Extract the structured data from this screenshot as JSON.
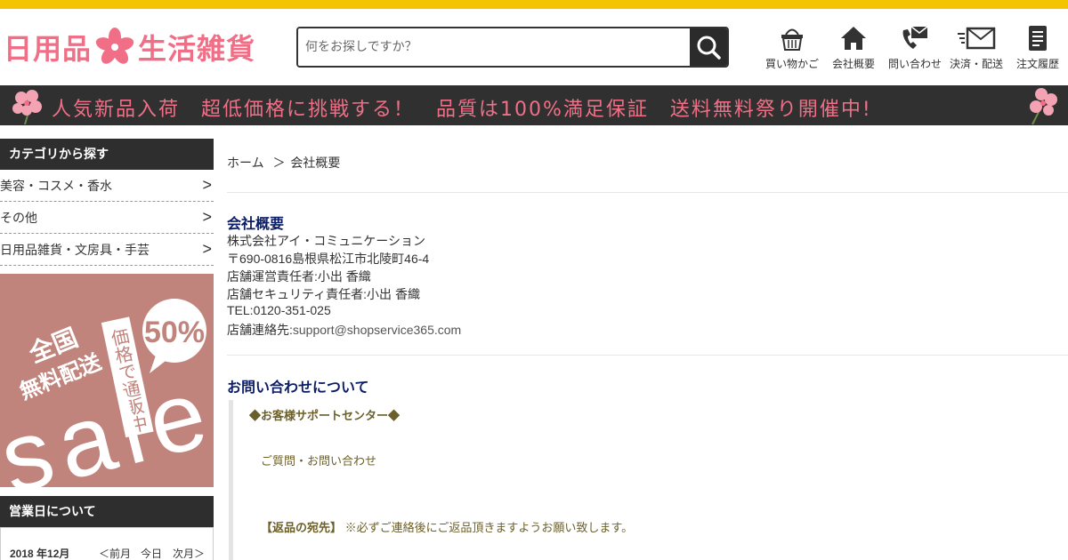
{
  "header": {
    "logo_left": "日用品",
    "logo_right": "生活雑貨",
    "search": {
      "placeholder": "何をお探しですか？"
    },
    "nav": [
      {
        "label": "買い物かご",
        "icon": "basket-icon"
      },
      {
        "label": "会社概要",
        "icon": "home-icon"
      },
      {
        "label": "問い合わせ",
        "icon": "phone-mail-icon"
      },
      {
        "label": "決済・配送",
        "icon": "fast-mail-icon"
      },
      {
        "label": "注文履歴",
        "icon": "document-icon"
      }
    ]
  },
  "banner": {
    "text": "人気新品入荷　超低価格に挑戦する！　品質は100%満足保証　送料無料祭り開催中!"
  },
  "sidebar": {
    "category_heading": "カテゴリから探す",
    "categories": [
      {
        "label": "美容・コスメ・香水",
        "arrow": ">"
      },
      {
        "label": "その他",
        "arrow": ">"
      },
      {
        "label": "日用品雑貨・文房具・手芸",
        "arrow": ">"
      }
    ],
    "sale_banner": {
      "line1": "全国",
      "line2": "無料配送",
      "vertical": "価格で通販中",
      "percent": "50%",
      "big": "sale"
    },
    "business_heading": "営業日について",
    "calendar": {
      "month": "2018 年12月",
      "prev": "＜前月",
      "today": "今日",
      "next": "次月＞"
    }
  },
  "main": {
    "breadcrumb": {
      "home": "ホーム",
      "sep": "＞",
      "current": "会社概要"
    },
    "company": {
      "title": "会社概要",
      "name": "株式会社アイ・コミュニケーション",
      "address": "〒690-0816島根県松江市北陵町46-4",
      "manager": "店舗運営責任者:小出 香織",
      "security": "店舗セキュリティ責任者:小出 香織",
      "tel": "TEL:0120-351-025",
      "contact_label": "店舗連絡先:",
      "contact_email": "support@shopservice365.com"
    },
    "inquiry": {
      "title": "お問い合わせについて",
      "support_center": "◆お客様サポートセンター◆",
      "questions": "ご質問・お問い合わせ",
      "return_label": "【返品の宛先】",
      "return_note": "※必ずご連絡後にご返品頂きますようお願い致します。"
    }
  },
  "colors": {
    "accent_yellow": "#f5c400",
    "logo_pink": "#f06f86",
    "dark_bar": "#303030",
    "sale_bg": "#c0847c",
    "title_navy": "#0b1c66",
    "olive_text": "#6b5f2a"
  }
}
